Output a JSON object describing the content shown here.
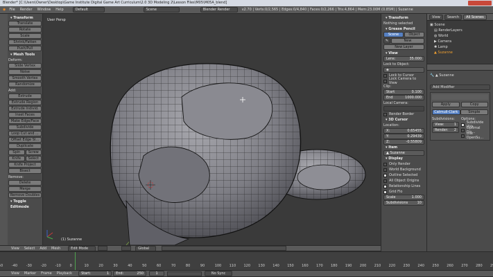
{
  "window_title": "Blender* [C:\\Users\\Owner\\Desktop\\Game Institute Digital Game Art Curriculum\\2.0 3D Modeling 2\\Lesson Files\\M05\\M05A_blend]",
  "info_bar": {
    "menus": [
      "File",
      "Render",
      "Window",
      "Help"
    ],
    "layout": "Default",
    "scene": "Scene",
    "engine": "Blender Render",
    "stats": "v2.70 | Verts:0/2,565 | Edges:0/4,840 | Faces:0/2,266 | Tris:4,864 | Mem:23.00M (0.85M) | Suzanne"
  },
  "tool_shelf": {
    "transform_header": "Transform",
    "transform_buttons": [
      "Translate",
      "Rotate",
      "Scale",
      "Shrink/Fatten",
      "Push/Pull"
    ],
    "mesh_tools_header": "Mesh Tools",
    "deform_label": "Deform:",
    "deform_buttons": [
      "Slide Vertex",
      "Noise",
      "Smooth Vertex",
      "Randomize"
    ],
    "add_label": "Add:",
    "add_buttons": [
      "Extrude",
      "Extrude Region",
      "Extrude Individ.",
      "Inset Faces",
      "Make Edge/Face",
      "Subdivide",
      "Loop Cut and ...",
      "Offset Edge Sl...",
      "Duplicate"
    ],
    "pair_rows": [
      [
        "Spin",
        "Screw"
      ],
      [
        "Knife",
        "Select"
      ]
    ],
    "add_buttons_2": [
      "Knife Project",
      "Bisect"
    ],
    "remove_label": "Remove:",
    "remove_buttons": [
      "Delete",
      "Merge",
      "Remove Doubles"
    ],
    "toggle_label": "Toggle Editmode"
  },
  "viewport": {
    "label": "User Persp",
    "object_label": "(1) Suzanne"
  },
  "view_header": {
    "menus": [
      "View",
      "Select",
      "Add",
      "Mesh"
    ],
    "mode": "Edit Mode",
    "pivot": "Global"
  },
  "properties_panel": {
    "transform_header": "Transform",
    "nothing_selected": "Nothing selected",
    "grease_header": "Grease Pencil",
    "scene_tab": "Scene",
    "object_tab": "Object",
    "new_btn": "New",
    "new_layer_btn": "New Layer",
    "view_header": "View",
    "lens_label": "Lens:",
    "lens_value": "35.000",
    "lock_to_object": "Lock to Object:",
    "lock_cursor": "Lock to Cursor",
    "lock_camera": "Lock Camera to View",
    "clip_label": "Clip:",
    "clip_start_label": "Start",
    "clip_start_value": "0.100",
    "clip_end_label": "End",
    "clip_end_value": "1000.000",
    "local_camera": "Local Camera:",
    "render_border": "Render Border",
    "cursor_header": "3D Cursor",
    "location_label": "Location:",
    "cursor_x_label": "X:",
    "cursor_x": "0.65455",
    "cursor_y_label": "Y:",
    "cursor_y": "0.29439",
    "cursor_z_label": "Z:",
    "cursor_z": "-0.55809",
    "item_header": "Item",
    "item_name": "Suzanne",
    "display_header": "Display",
    "only_render": "Only Render",
    "world_background": "World Background",
    "outline_selected": "Outline Selected",
    "all_object_origins": "All Object Origins",
    "relationship_lines": "Relationship Lines",
    "grid_floor": "Grid Flo",
    "scale_label": "Scale",
    "scale_value": "1.000",
    "subdiv_label": "Subdivisions",
    "subdiv_value": "10"
  },
  "outliner": {
    "tabs": [
      "View",
      "Search",
      "All Scenes"
    ],
    "items": [
      "Scene",
      "RenderLayers",
      "World",
      "Camera",
      "Lamp",
      "Suzanne"
    ]
  },
  "modifier_panel": {
    "object_name": "Suzanne",
    "add_modifier": "Add Modifier",
    "apply": "Apply",
    "copy": "Copy",
    "catmull": "Catmull-Clark",
    "simple": "Simple",
    "subdivisions_label": "Subdivisions:",
    "options_label": "Options:",
    "view_label": "View:",
    "view_value": "1",
    "render_label": "Render:",
    "render_value": "2",
    "subdivide_uvs": "Subdivide UVs",
    "optimal_display": "Optimal Dis...",
    "use_opensubdiv": "Use OpenSu..."
  },
  "timeline": {
    "ticks": [
      "-50",
      "-40",
      "-30",
      "-20",
      "-10",
      "0",
      "10",
      "20",
      "30",
      "40",
      "50",
      "60",
      "70",
      "80",
      "90",
      "100",
      "110",
      "120",
      "130",
      "140",
      "150",
      "160",
      "170",
      "180",
      "190",
      "200",
      "210",
      "220",
      "230",
      "240",
      "250",
      "260",
      "270",
      "280",
      "290"
    ],
    "menus": [
      "View",
      "Marker",
      "Frame",
      "Playback"
    ],
    "start_label": "Start:",
    "start_value": "1",
    "end_label": "End:",
    "end_value": "250",
    "current_frame": "1",
    "sync": "No Sync"
  }
}
